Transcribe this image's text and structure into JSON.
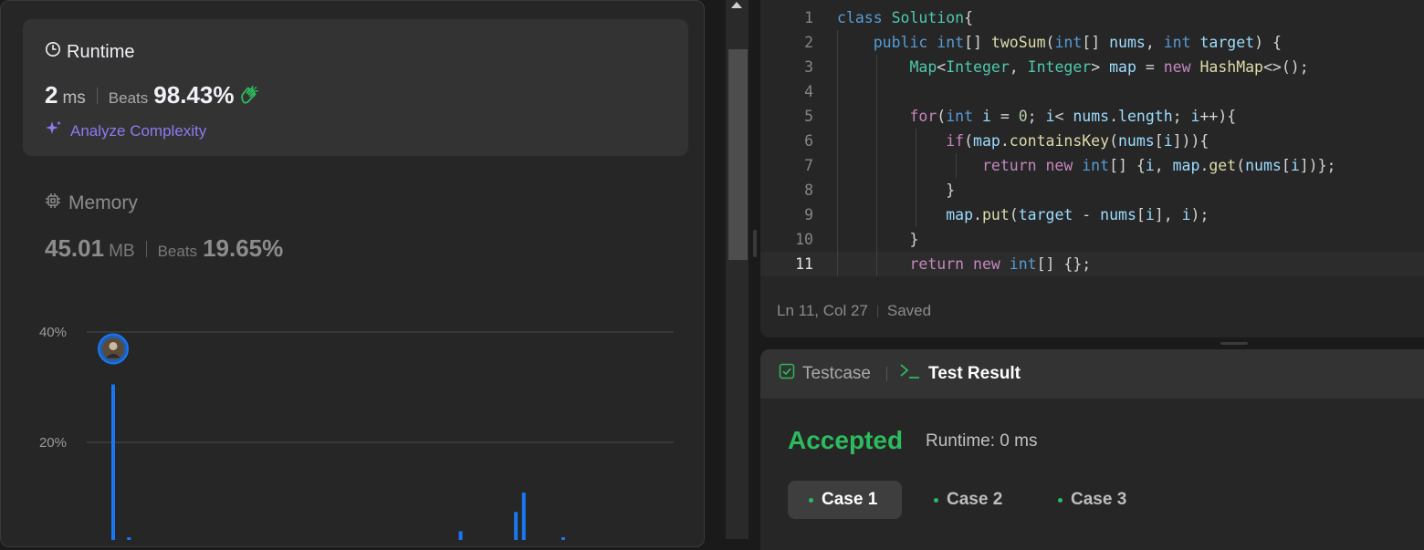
{
  "runtime": {
    "title": "Runtime",
    "value": "2",
    "unit": "ms",
    "beats_label": "Beats",
    "beats_value": "98.43%",
    "analyze_label": "Analyze Complexity"
  },
  "memory": {
    "title": "Memory",
    "value": "45.01",
    "unit": "MB",
    "beats_label": "Beats",
    "beats_value": "19.65%"
  },
  "chart_data": {
    "type": "bar",
    "ylabel": "",
    "xlabel": "",
    "y_ticks": [
      "20%",
      "40%"
    ],
    "ylim": [
      0,
      40
    ],
    "grid": true,
    "bar_color": "#1877f2",
    "x": [
      0,
      1,
      2,
      3,
      44,
      51,
      52,
      53,
      57
    ],
    "values": [
      30.5,
      1.5,
      2.8,
      1.6,
      3.9,
      7.4,
      10.9,
      0.6,
      2.8
    ],
    "marker_index": 0
  },
  "editor": {
    "lines": [
      {
        "n": "1",
        "indent": 0,
        "tokens": [
          [
            "kw",
            "class "
          ],
          [
            "ty",
            "Solution"
          ],
          [
            "",
            "{"
          ]
        ]
      },
      {
        "n": "2",
        "indent": 1,
        "tokens": [
          [
            "kw",
            "public "
          ],
          [
            "kw",
            "int"
          ],
          [
            "",
            "[] "
          ],
          [
            "fn",
            "twoSum"
          ],
          [
            "",
            "("
          ],
          [
            "kw",
            "int"
          ],
          [
            "",
            "[] "
          ],
          [
            "vr",
            "nums"
          ],
          [
            "",
            ", "
          ],
          [
            "kw",
            "int "
          ],
          [
            "vr",
            "target"
          ],
          [
            "",
            ") {"
          ]
        ]
      },
      {
        "n": "3",
        "indent": 2,
        "tokens": [
          [
            "ty",
            "Map"
          ],
          [
            "",
            "<"
          ],
          [
            "ty",
            "Integer"
          ],
          [
            "",
            ", "
          ],
          [
            "ty",
            "Integer"
          ],
          [
            "",
            "> "
          ],
          [
            "vr",
            "map"
          ],
          [
            "",
            " = "
          ],
          [
            "ct",
            "new "
          ],
          [
            "fn",
            "HashMap"
          ],
          [
            "",
            "<>();"
          ]
        ]
      },
      {
        "n": "4",
        "indent": 2,
        "tokens": []
      },
      {
        "n": "5",
        "indent": 2,
        "tokens": [
          [
            "ct",
            "for"
          ],
          [
            "",
            "("
          ],
          [
            "kw",
            "int "
          ],
          [
            "vr",
            "i"
          ],
          [
            "",
            " = "
          ],
          [
            "num",
            "0"
          ],
          [
            "",
            "; "
          ],
          [
            "vr",
            "i"
          ],
          [
            "",
            "< "
          ],
          [
            "vr",
            "nums"
          ],
          [
            "",
            "."
          ],
          [
            "vr",
            "length"
          ],
          [
            "",
            "; "
          ],
          [
            "vr",
            "i"
          ],
          [
            "",
            "++){"
          ]
        ]
      },
      {
        "n": "6",
        "indent": 3,
        "tokens": [
          [
            "ct",
            "if"
          ],
          [
            "",
            "("
          ],
          [
            "vr",
            "map"
          ],
          [
            "",
            "."
          ],
          [
            "fn",
            "containsKey"
          ],
          [
            "",
            "("
          ],
          [
            "vr",
            "nums"
          ],
          [
            "",
            "["
          ],
          [
            "vr",
            "i"
          ],
          [
            "",
            "])){"
          ]
        ]
      },
      {
        "n": "7",
        "indent": 4,
        "tokens": [
          [
            "ct",
            "return "
          ],
          [
            "ct",
            "new "
          ],
          [
            "kw",
            "int"
          ],
          [
            "",
            "[] {"
          ],
          [
            "vr",
            "i"
          ],
          [
            "",
            ", "
          ],
          [
            "vr",
            "map"
          ],
          [
            "",
            "."
          ],
          [
            "fn",
            "get"
          ],
          [
            "",
            "("
          ],
          [
            "vr",
            "nums"
          ],
          [
            "",
            "["
          ],
          [
            "vr",
            "i"
          ],
          [
            "",
            "])};"
          ]
        ]
      },
      {
        "n": "8",
        "indent": 3,
        "tokens": [
          [
            "",
            "}"
          ]
        ]
      },
      {
        "n": "9",
        "indent": 3,
        "tokens": [
          [
            "vr",
            "map"
          ],
          [
            "",
            "."
          ],
          [
            "fn",
            "put"
          ],
          [
            "",
            "("
          ],
          [
            "vr",
            "target"
          ],
          [
            "",
            " - "
          ],
          [
            "vr",
            "nums"
          ],
          [
            "",
            "["
          ],
          [
            "vr",
            "i"
          ],
          [
            "",
            "], "
          ],
          [
            "vr",
            "i"
          ],
          [
            "",
            ");"
          ]
        ]
      },
      {
        "n": "10",
        "indent": 2,
        "tokens": [
          [
            "",
            "}"
          ]
        ]
      },
      {
        "n": "11",
        "indent": 2,
        "tokens": [
          [
            "ct",
            "return "
          ],
          [
            "ct",
            "new "
          ],
          [
            "kw",
            "int"
          ],
          [
            "",
            "[] {};"
          ]
        ]
      }
    ],
    "current_line": "11"
  },
  "statusbar": {
    "position": "Ln 11, Col 27",
    "state": "Saved"
  },
  "tabs": {
    "testcase": "Testcase",
    "test_result": "Test Result"
  },
  "result": {
    "status": "Accepted",
    "runtime_text": "Runtime: 0 ms",
    "cases": [
      "Case 1",
      "Case 2",
      "Case 3"
    ]
  },
  "colors": {
    "accepted": "#2cbb5d",
    "accent_purple": "#8a7bf0",
    "bar": "#1877f2"
  }
}
